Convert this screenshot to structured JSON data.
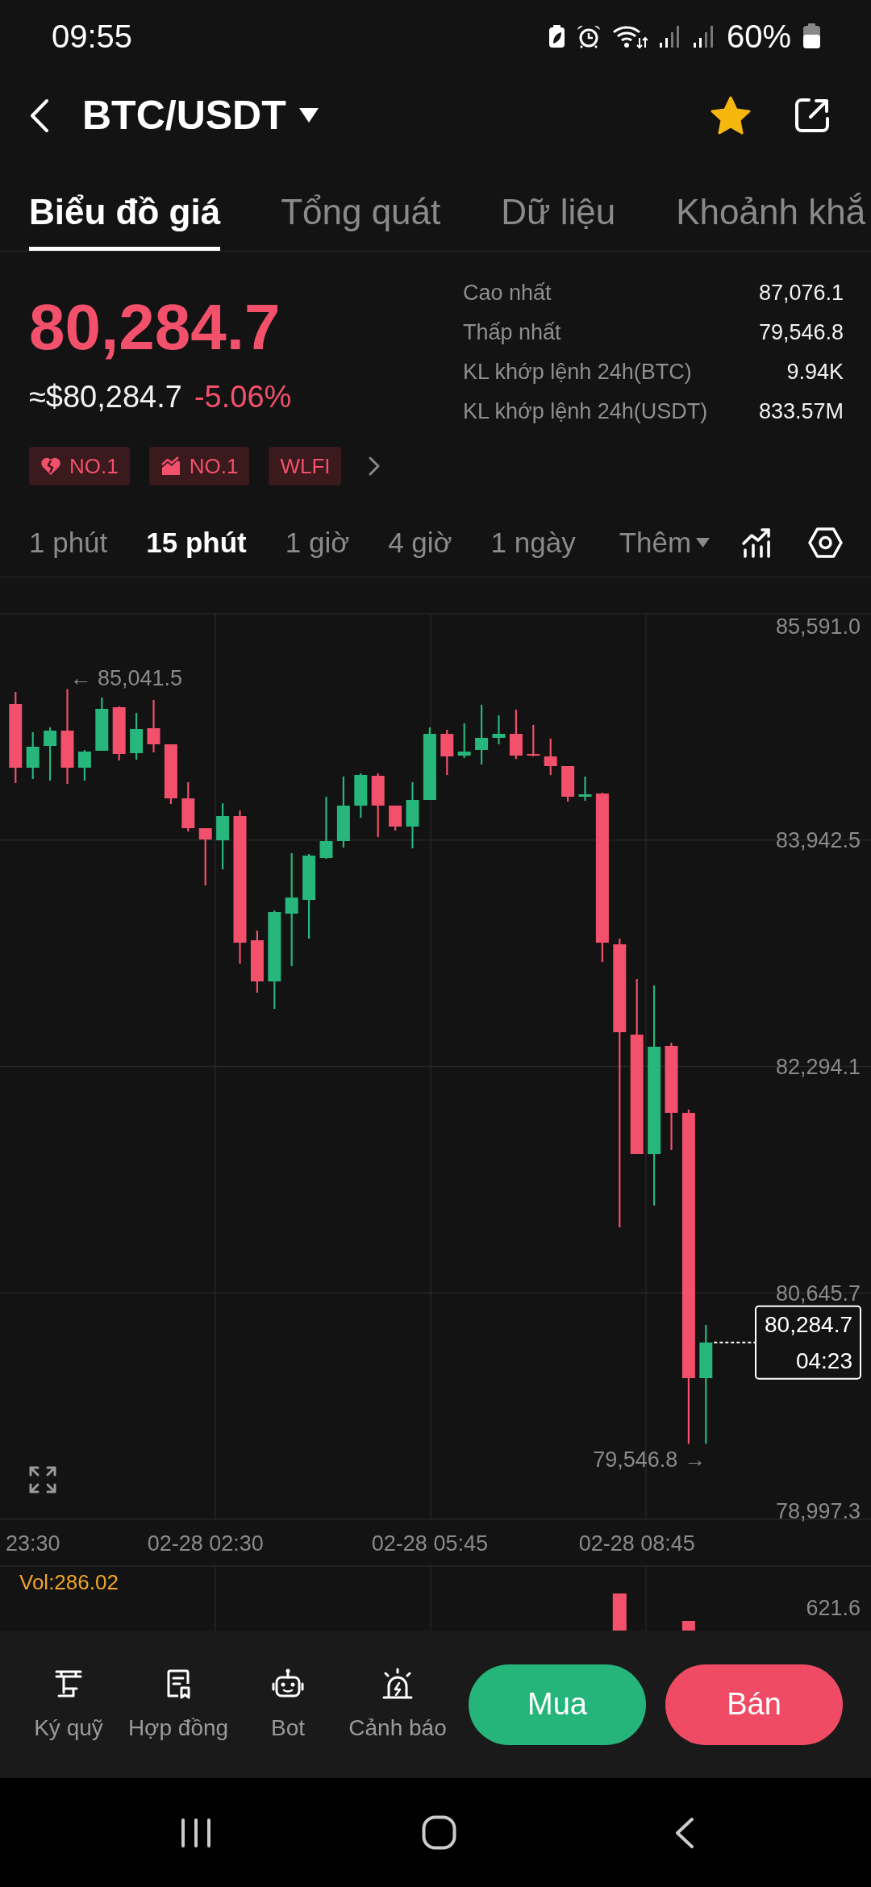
{
  "status_bar": {
    "time": "09:55",
    "battery": "60%"
  },
  "header": {
    "pair": "BTC/USDT",
    "favorite": true
  },
  "tabs": [
    {
      "label": "Biểu đồ giá",
      "selected": true
    },
    {
      "label": "Tổng quát",
      "selected": false
    },
    {
      "label": "Dữ liệu",
      "selected": false
    },
    {
      "label": "Khoảnh khắ",
      "selected": false
    }
  ],
  "ticker": {
    "price": "80,284.7",
    "fiat_price": "≈$80,284.7",
    "change": "-5.06%"
  },
  "stats": [
    {
      "label": "Cao nhất",
      "value": "87,076.1"
    },
    {
      "label": "Thấp nhất",
      "value": "79,546.8"
    },
    {
      "label": "KL khớp lệnh 24h(BTC)",
      "value": "9.94K"
    },
    {
      "label": "KL khớp lệnh 24h(USDT)",
      "value": "833.57M"
    }
  ],
  "tags": [
    {
      "kind": "heart",
      "label": "NO.1"
    },
    {
      "kind": "trend",
      "label": "NO.1"
    },
    {
      "kind": "text",
      "label": "WLFI"
    }
  ],
  "intervals": [
    {
      "label": "1 phút",
      "selected": false
    },
    {
      "label": "15 phút",
      "selected": true
    },
    {
      "label": "1 giờ",
      "selected": false
    },
    {
      "label": "4 giờ",
      "selected": false
    },
    {
      "label": "1 ngày",
      "selected": false
    }
  ],
  "more": {
    "label": "Thêm"
  },
  "chart": {
    "chart_data": {
      "type": "candlestick",
      "grid": true,
      "categories": [
        null,
        "23:30",
        null,
        null,
        null,
        null,
        null,
        null,
        null,
        null,
        null,
        "02-28 02:30",
        null,
        null,
        null,
        null,
        null,
        null,
        null,
        null,
        null,
        null,
        null,
        null,
        "02-28 05:45",
        null,
        null,
        null,
        null,
        null,
        null,
        null,
        null,
        null,
        null,
        null,
        "02-28 08:45",
        null,
        null,
        null,
        null
      ],
      "ohlc": [
        [
          84933.4,
          85021.5,
          84358.0,
          84469.5
        ],
        [
          84469.5,
          84727.9,
          84387.3,
          84622.2
        ],
        [
          84628.1,
          84763.1,
          84375.6,
          84739.6
        ],
        [
          84739.6,
          85041.5,
          84352.1,
          84469.5
        ],
        [
          84469.5,
          84598.7,
          84375.6,
          84587.0
        ],
        [
          84592.8,
          84980.4,
          84592.8,
          84898.2
        ],
        [
          84909.9,
          84915.8,
          84522.4,
          84569.4
        ],
        [
          84575.2,
          84868.8,
          84528.3,
          84751.4
        ],
        [
          84757.2,
          84962.7,
          84581.1,
          84639.8
        ],
        [
          84639.8,
          84639.8,
          84205.3,
          84246.4
        ],
        [
          84246.4,
          84363.9,
          84005.7,
          84029.2
        ],
        [
          84029.2,
          84029.2,
          83612.3,
          83947.0
        ],
        [
          83941.1,
          84211.2,
          83729.7,
          84117.3
        ],
        [
          84117.3,
          84158.4,
          83042.8,
          83195.4
        ],
        [
          83213.0,
          83283.5,
          82831.4,
          82913.6
        ],
        [
          82913.6,
          83430.3,
          82714.0,
          83418.5
        ],
        [
          83406.8,
          83847.2,
          83025.2,
          83524.2
        ],
        [
          83506.6,
          83841.3,
          83224.8,
          83829.5
        ],
        [
          83811.9,
          84258.2,
          83806.1,
          83935.2
        ],
        [
          83935.2,
          84405.0,
          83888.3,
          84193.6
        ],
        [
          84193.6,
          84428.4,
          84105.5,
          84416.7
        ],
        [
          84410.8,
          84428.4,
          83964.6,
          84193.6
        ],
        [
          84193.6,
          84193.6,
          84011.6,
          84040.9
        ],
        [
          84040.9,
          84363.9,
          83882.4,
          84234.7
        ],
        [
          84234.7,
          84763.1,
          84234.7,
          84716.1
        ],
        [
          84716.1,
          84745.5,
          84416.7,
          84551.7
        ],
        [
          84557.6,
          84792.5,
          84540.0,
          84587.0
        ],
        [
          84598.7,
          84927.5,
          84493.0,
          84686.8
        ],
        [
          84686.8,
          84851.2,
          84639.8,
          84716.1
        ],
        [
          84716.1,
          84892.3,
          84534.1,
          84557.6
        ],
        [
          84569.4,
          84780.7,
          84551.7,
          84557.6
        ],
        [
          84551.7,
          84680.9,
          84416.7,
          84481.3
        ],
        [
          84481.3,
          84481.3,
          84222.9,
          84258.2
        ],
        [
          84258.2,
          84405.0,
          84228.8,
          84275.8
        ],
        [
          84281.7,
          84287.5,
          83054.5,
          83195.4
        ],
        [
          83183.7,
          83224.8,
          81122.8,
          82543.7
        ],
        [
          82526.1,
          82931.2,
          81657.1,
          81657.1
        ],
        [
          81657.1,
          82884.2,
          81281.3,
          82438.0
        ],
        [
          82443.9,
          82467.4,
          81686.5,
          81956.5
        ],
        [
          81956.5,
          81980.0,
          79546.8,
          80024.8
        ],
        [
          80024.8,
          80412.3,
          79546.8,
          80284.7
        ]
      ],
      "ylim": [
        78997.3,
        85591.0
      ],
      "yticks": [
        {
          "value": 85591.0,
          "label": "85,591.0"
        },
        {
          "value": 83942.5,
          "label": "83,942.5"
        },
        {
          "value": 82294.1,
          "label": "82,294.1"
        },
        {
          "value": 80645.7,
          "label": "80,645.7"
        },
        {
          "value": 78997.3,
          "label": "78,997.3"
        }
      ]
    },
    "high_marker": "← 85,041.5",
    "low_marker": "79,546.8 →",
    "last_price": "80,284.7",
    "countdown": "04:23"
  },
  "volume": {
    "label": "Vol:286.02",
    "axis_label": "621.6"
  },
  "actions": [
    {
      "kind": "margin",
      "label": "Ký quỹ"
    },
    {
      "kind": "contract",
      "label": "Hợp đồng"
    },
    {
      "kind": "bot",
      "label": "Bot"
    },
    {
      "kind": "alert",
      "label": "Cảnh báo"
    }
  ],
  "trade_buttons": [
    {
      "kind": "buy",
      "label": "Mua"
    },
    {
      "kind": "sell",
      "label": "Bán"
    }
  ]
}
